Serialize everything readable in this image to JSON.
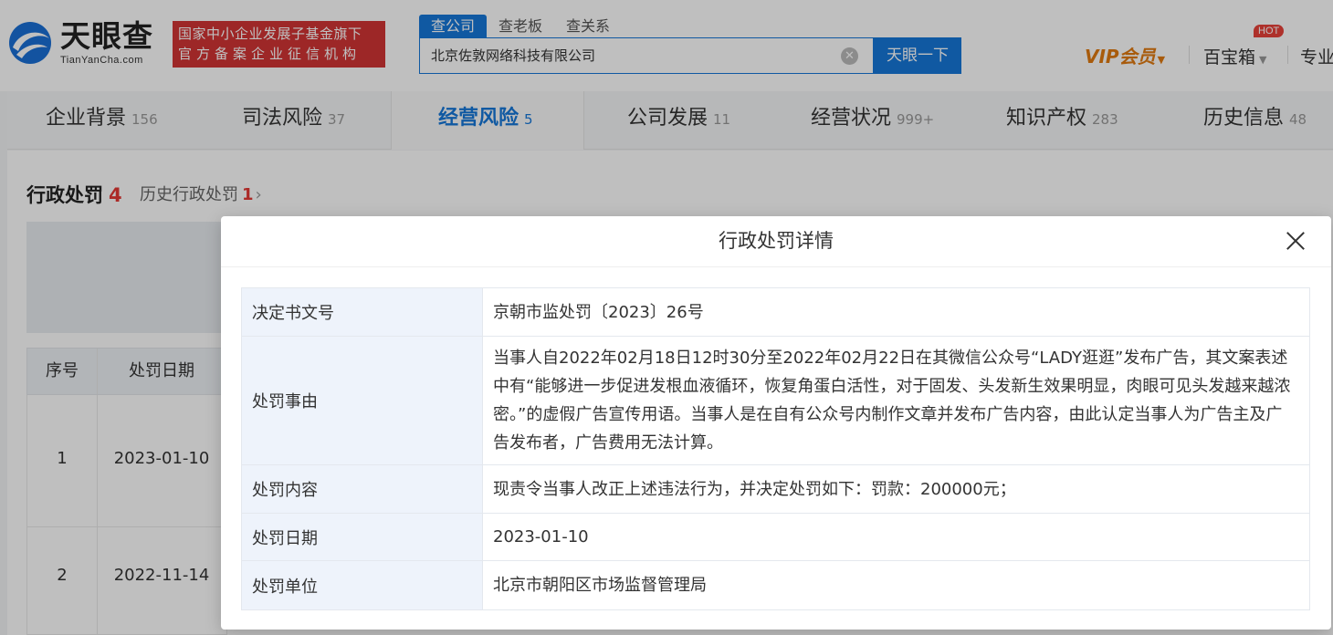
{
  "header": {
    "logo_text": "天眼查",
    "logo_sub": "TianYanCha.com",
    "slogan_line1": "国家中小企业发展子基金旗下",
    "slogan_line2": "官方备案企业征信机构",
    "search_tabs": [
      "查公司",
      "查老板",
      "查关系"
    ],
    "search_value": "北京佐敦网络科技有限公司",
    "search_button": "天眼一下",
    "vip_label": "VIP会员",
    "baoxiang_label": "百宝箱",
    "hot_badge": "HOT",
    "pro_label": "专业"
  },
  "nav": [
    {
      "label": "企业背景",
      "count": "156"
    },
    {
      "label": "司法风险",
      "count": "37"
    },
    {
      "label": "经营风险",
      "count": "5"
    },
    {
      "label": "公司发展",
      "count": "11"
    },
    {
      "label": "经营状况",
      "count": "999+"
    },
    {
      "label": "知识产权",
      "count": "283"
    },
    {
      "label": "历史信息",
      "count": "48"
    }
  ],
  "section": {
    "title": "行政处罚",
    "count": "4",
    "history_label": "历史行政处罚",
    "history_count": "1",
    "columns": [
      "序号",
      "处罚日期"
    ],
    "rows": [
      {
        "index": "1",
        "date": "2023-01-10"
      },
      {
        "index": "2",
        "date": "2022-11-14"
      }
    ]
  },
  "modal": {
    "title": "行政处罚详情",
    "fields": [
      {
        "label": "决定书文号",
        "value": "京朝市监处罚〔2023〕26号"
      },
      {
        "label": "处罚事由",
        "value": "当事人自2022年02月18日12时30分至2022年02月22日在其微信公众号“LADY逛逛”发布广告，其文案表述中有“能够进一步促进发根血液循环，恢复角蛋白活性，对于固发、头发新生效果明显，肉眼可见头发越来越浓密。”的虚假广告宣传用语。当事人是在自有公众号内制作文章并发布广告内容，由此认定当事人为广告主及广告发布者，广告费用无法计算。"
      },
      {
        "label": "处罚内容",
        "value": "现责令当事人改正上述违法行为，并决定处罚如下：罚款：200000元；"
      },
      {
        "label": "处罚日期",
        "value": "2023-01-10"
      },
      {
        "label": "处罚单位",
        "value": "北京市朝阳区市场监督管理局"
      }
    ]
  },
  "colors": {
    "brand_blue": "#1677d9",
    "slogan_red": "#d23535",
    "vip_orange": "#e07a10",
    "count_red": "#e53935"
  },
  "icons": [
    "logo-swirl-icon",
    "clear-icon",
    "chevron-down-icon",
    "chevron-right-icon",
    "close-icon"
  ]
}
